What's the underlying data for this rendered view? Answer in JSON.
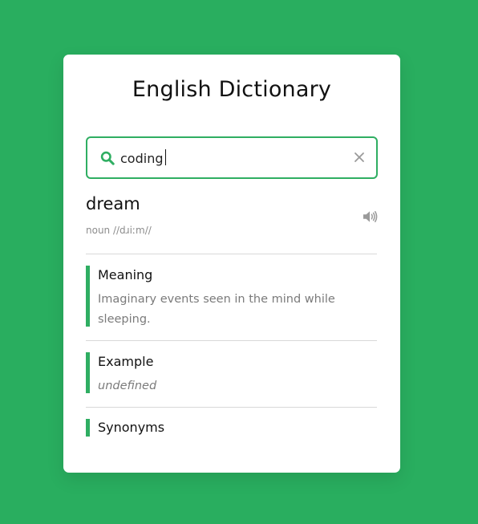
{
  "app": {
    "title": "English Dictionary"
  },
  "search": {
    "value": "coding",
    "placeholder": ""
  },
  "result": {
    "word": "dream",
    "phonetic": "noun //dɹiːm//"
  },
  "sections": {
    "meaning": {
      "title": "Meaning",
      "text": "Imaginary events seen in the mind while sleeping."
    },
    "example": {
      "title": "Example",
      "text": "undefined"
    },
    "synonyms": {
      "title": "Synonyms"
    }
  },
  "icons": {
    "search": "search-icon",
    "clear": "close-icon",
    "speaker": "volume-icon"
  },
  "colors": {
    "background": "#29ae5f",
    "accent": "#2fae62",
    "card": "#ffffff"
  }
}
